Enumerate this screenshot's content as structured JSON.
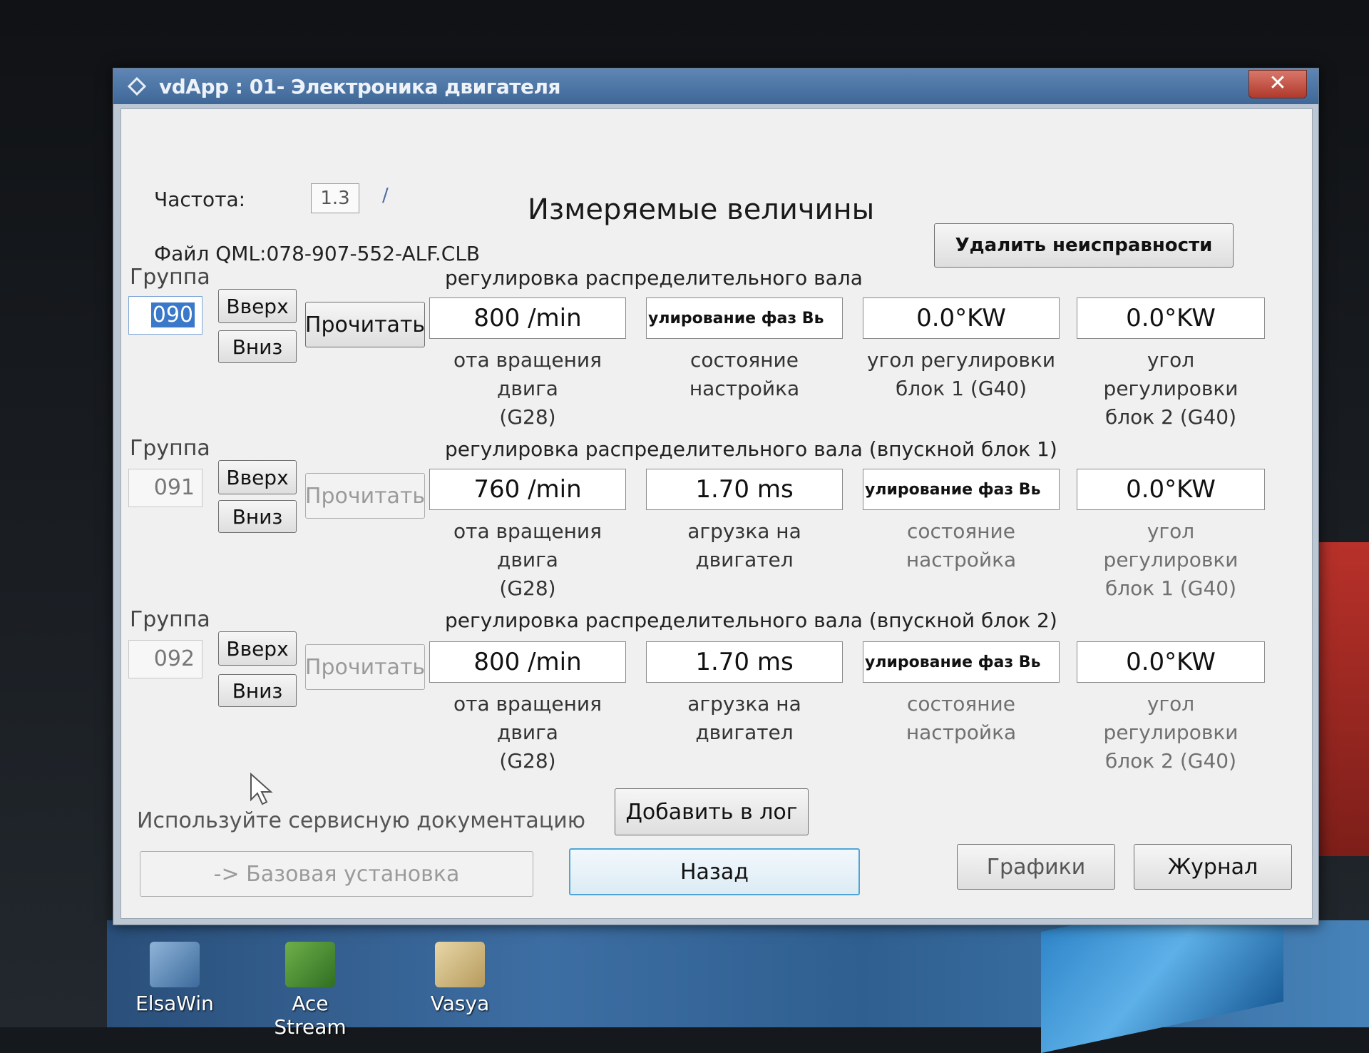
{
  "window": {
    "title": "vdApp : 01- Электроника двигателя"
  },
  "header": {
    "frequency_label": "Частота:",
    "frequency_value": "1.3",
    "frequency_unit": "/",
    "file_label": "Файл QML:078-907-552-ALF.CLB",
    "page_title": "Измеряемые величины",
    "clear_faults_label": "Удалить неисправности"
  },
  "groups": [
    {
      "group_label": "Группа",
      "number": "090",
      "up_label": "Вверх",
      "down_label": "Вниз",
      "read_label": "Прочитать",
      "title": "регулировка распределительного вала",
      "fields": [
        {
          "value": "800 /min",
          "caption_1": "ота вращения двига",
          "caption_2": "(G28)"
        },
        {
          "value": "улирование фаз Вь",
          "caption_1": "состояние",
          "caption_2": "настройка"
        },
        {
          "value": "0.0°KW",
          "caption_1": "угол регулировки",
          "caption_2": "блок 1 (G40)"
        },
        {
          "value": "0.0°KW",
          "caption_1": "угол регулировки",
          "caption_2": "блок 2 (G40)"
        }
      ]
    },
    {
      "group_label": "Группа",
      "number": "091",
      "up_label": "Вверх",
      "down_label": "Вниз",
      "read_label": "Прочитать",
      "title": "регулировка распределительного вала (впускной блок 1)",
      "fields": [
        {
          "value": "760 /min",
          "caption_1": "ота вращения двига",
          "caption_2": "(G28)"
        },
        {
          "value": "1.70 ms",
          "caption_1": "агрузка на двигател",
          "caption_2": ""
        },
        {
          "value": "улирование фаз Вь",
          "caption_1": "состояние",
          "caption_2": "настройка"
        },
        {
          "value": "0.0°KW",
          "caption_1": "угол регулировки",
          "caption_2": "блок 1 (G40)"
        }
      ]
    },
    {
      "group_label": "Группа",
      "number": "092",
      "up_label": "Вверх",
      "down_label": "Вниз",
      "read_label": "Прочитать",
      "title": "регулировка распределительного вала (впускной блок 2)",
      "fields": [
        {
          "value": "800 /min",
          "caption_1": "ота вращения двига",
          "caption_2": "(G28)"
        },
        {
          "value": "1.70 ms",
          "caption_1": "агрузка на двигател",
          "caption_2": ""
        },
        {
          "value": "улирование фаз Вь",
          "caption_1": "состояние",
          "caption_2": "настройка"
        },
        {
          "value": "0.0°KW",
          "caption_1": "угол регулировки",
          "caption_2": "блок 2 (G40)"
        }
      ]
    }
  ],
  "footer": {
    "service_note": "Используйте сервисную документацию",
    "add_to_log_label": "Добавить в лог",
    "basic_setting_label": "-> Базовая установка",
    "back_label": "Назад",
    "graphs_label": "Графики",
    "journal_label": "Журнал"
  },
  "desktop_icons": [
    {
      "label": "ElsaWin"
    },
    {
      "label": "Ace Stream"
    },
    {
      "label": "Vasya"
    }
  ],
  "colors": {
    "titlebar": "#3e6797",
    "field_text_active": "#111111",
    "selected_group": "#3a78c9"
  }
}
